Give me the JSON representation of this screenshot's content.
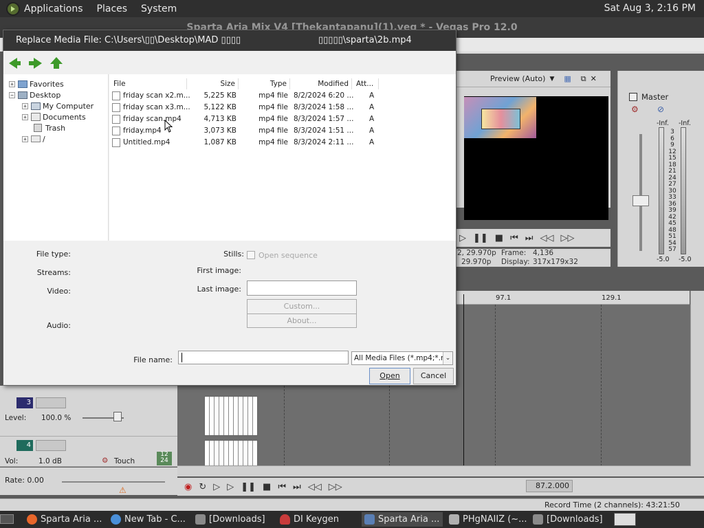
{
  "top_panel": {
    "menus": [
      "Applications",
      "Places",
      "System"
    ],
    "clock": "Sat Aug  3,  2:16 PM"
  },
  "vegas": {
    "title": "Sparta Aria Mix V4 [Thekantapanu](1).veg * - Vegas Pro 12.0",
    "preview_label": "Preview (Auto)",
    "info": {
      "project_value": "2, 29.970p",
      "preview_value": "29.970p",
      "frame_label": "Frame:",
      "frame_value": "4,136",
      "display_label": "Display:",
      "display_value": "317x179x32"
    },
    "master": {
      "label": "Master",
      "inf_left": "-Inf.",
      "inf_right": "-Inf.",
      "scale": [
        "3",
        "6",
        "9",
        "12",
        "15",
        "18",
        "21",
        "24",
        "27",
        "30",
        "33",
        "36",
        "39",
        "42",
        "45",
        "48",
        "51",
        "54",
        "57"
      ],
      "val_left": "-5.0",
      "val_right": "-5.0"
    },
    "ruler": {
      "mark1": "97.1",
      "mark2": "129.1"
    },
    "tracks": [
      {
        "number": "3",
        "label": "Level:",
        "value": "100.0 %",
        "color": "#2c2c6e"
      },
      {
        "number": "4",
        "label": "Vol:",
        "value": "1.0 dB",
        "extra": "Touch",
        "color": "#1f6b5c"
      }
    ],
    "track4_badge_a": "12",
    "track4_badge_b": "24",
    "rate": "Rate: 0.00",
    "position": "87.2.000",
    "status": "Record Time (2 channels): 43:21:50"
  },
  "dialog": {
    "title": "Replace Media File: C:\\Users\\▯▯\\Desktop\\MAD ▯▯▯▯",
    "title_right": "▯▯▯▯▯\\sparta\\2b.mp4",
    "tree": [
      {
        "label": "Favorites",
        "icon": "folder-blue-icon",
        "expander": "+"
      },
      {
        "label": "Desktop",
        "icon": "desktop-folder-icon",
        "expander": "−"
      },
      {
        "label": "My Computer",
        "icon": "computer-icon",
        "expander": "+"
      },
      {
        "label": "Documents",
        "icon": "documents-folder-icon",
        "expander": "+"
      },
      {
        "label": "Trash",
        "icon": "trash-icon",
        "expander": ""
      },
      {
        "label": "/",
        "icon": "drive-icon",
        "expander": "+"
      }
    ],
    "columns": {
      "file": "File",
      "size": "Size",
      "type": "Type",
      "modified": "Modified",
      "attr": "Att..."
    },
    "files": [
      {
        "name": "friday scan x2.m...",
        "size": "5,225 KB",
        "type": "mp4 file",
        "modified": "8/2/2024 6:20 ...",
        "attr": "A"
      },
      {
        "name": "friday scan x3.m...",
        "size": "5,122 KB",
        "type": "mp4 file",
        "modified": "8/3/2024 1:58 ...",
        "attr": "A"
      },
      {
        "name": "friday scan.mp4",
        "size": "4,713 KB",
        "type": "mp4 file",
        "modified": "8/3/2024 1:57 ...",
        "attr": "A"
      },
      {
        "name": "friday.mp4",
        "size": "3,073 KB",
        "type": "mp4 file",
        "modified": "8/3/2024 1:51 ...",
        "attr": "A"
      },
      {
        "name": "Untitled.mp4",
        "size": "1,087 KB",
        "type": "mp4 file",
        "modified": "8/3/2024 2:11 ...",
        "attr": "A"
      }
    ],
    "props": {
      "file_type": "File type:",
      "streams": "Streams:",
      "video": "Video:",
      "audio": "Audio:",
      "stills": "Stills:",
      "open_sequence": "Open sequence",
      "first_image": "First image:",
      "last_image": "Last image:",
      "custom": "Custom...",
      "about": "About..."
    },
    "file_name_label": "File name:",
    "file_name_value": "",
    "filter": "All Media Files (*.mp4;*.m",
    "open": "Open",
    "cancel": "Cancel"
  },
  "taskbar": {
    "tasks": [
      {
        "label": "Sparta Aria ...",
        "icon": "firefox-icon",
        "color": "#e8662a"
      },
      {
        "label": "New Tab - C...",
        "icon": "chrome-icon",
        "color": "#4a8fd8"
      },
      {
        "label": "[Downloads]",
        "icon": "folder-icon",
        "color": "#8a8a8a"
      },
      {
        "label": "DI Keygen",
        "icon": "keygen-icon",
        "color": "#c83b3b"
      },
      {
        "label": "Sparta Aria ...",
        "icon": "vegas-icon",
        "color": "#5a7fb5"
      },
      {
        "label": "PHgNAIIZ (~...",
        "icon": "text-editor-icon",
        "color": "#b0b0b0"
      },
      {
        "label": "[Downloads]",
        "icon": "folder-icon",
        "color": "#8a8a8a"
      }
    ]
  }
}
